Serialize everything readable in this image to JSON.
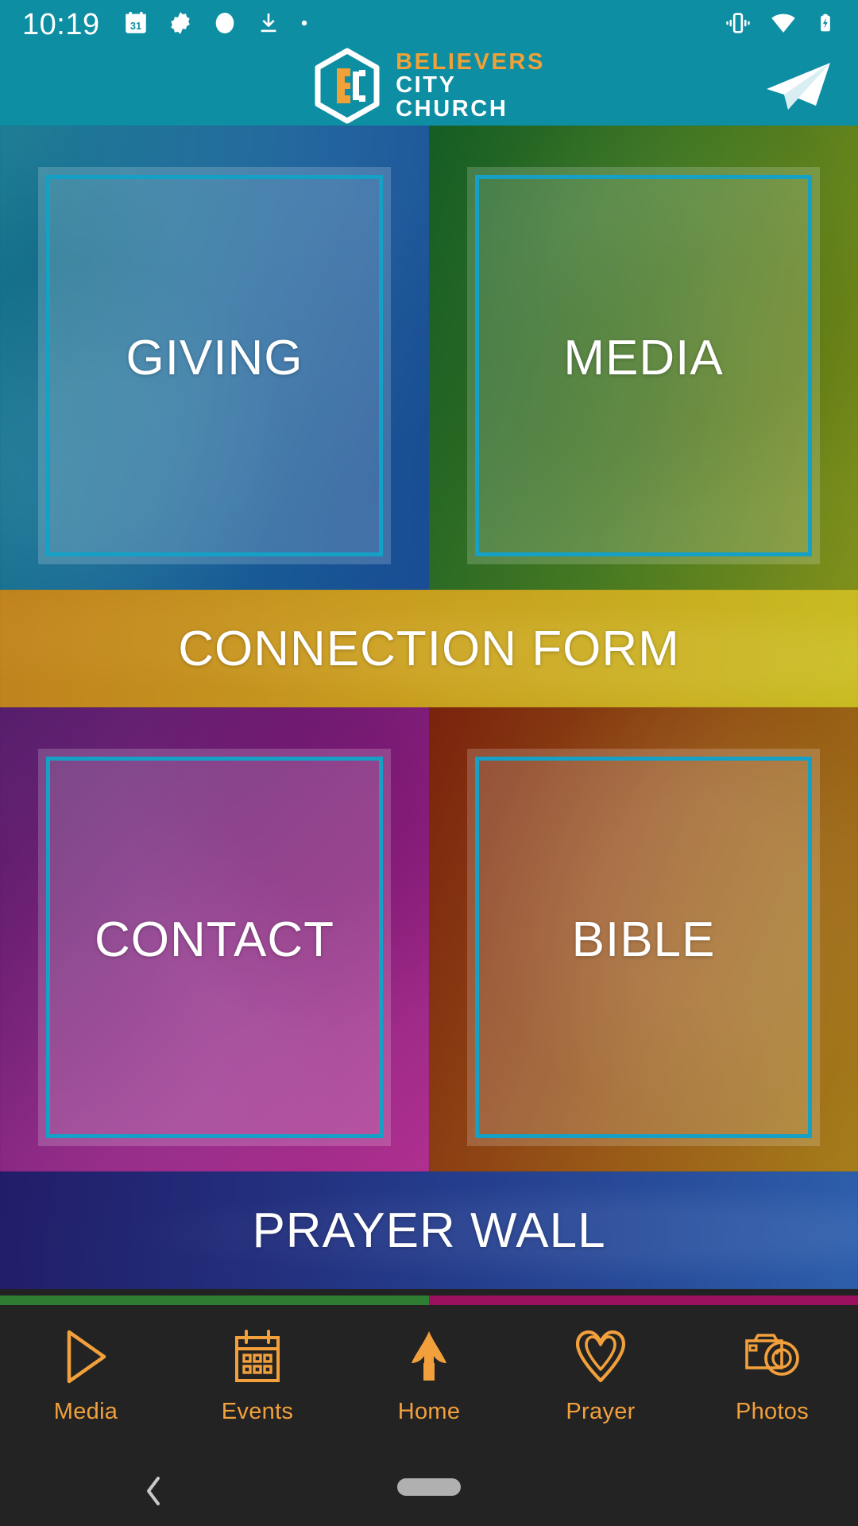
{
  "status_bar": {
    "time": "10:19",
    "left_icons": [
      "calendar-31-icon",
      "gear-icon",
      "circle-icon",
      "download-icon",
      "dot-icon"
    ],
    "calendar_day": "31",
    "right_icons": [
      "vibrate-icon",
      "wifi-icon",
      "battery-charging-icon"
    ]
  },
  "header": {
    "brand_line1": "BELIEVERS",
    "brand_line2": "CITY",
    "brand_line3": "CHURCH",
    "logo_icon": "believers-city-church-logo",
    "send_icon": "paper-plane-send-icon",
    "background_color": "#0d8ea3",
    "brand_accent_color": "#f0a137"
  },
  "tiles": {
    "giving": "GIVING",
    "media": "MEDIA",
    "connection_form": "CONNECTION FORM",
    "contact": "CONTACT",
    "bible": "BIBLE",
    "prayer_wall": "PRAYER WALL"
  },
  "tabbar": {
    "items": [
      {
        "label": "Media",
        "icon": "play-triangle-icon"
      },
      {
        "label": "Events",
        "icon": "calendar-icon"
      },
      {
        "label": "Home",
        "icon": "home-icon"
      },
      {
        "label": "Prayer",
        "icon": "heart-icon"
      },
      {
        "label": "Photos",
        "icon": "camera-icon"
      }
    ],
    "active": "Home",
    "accent_color": "#f2a03c",
    "background_color": "#232323"
  },
  "system_nav": {
    "back_icon": "back-chevron-icon",
    "home_icon": "home-pill-icon"
  },
  "accents": {
    "frame_border": "#15a0c6",
    "strip_left": "#2e7d32",
    "strip_right": "#9c1060"
  }
}
